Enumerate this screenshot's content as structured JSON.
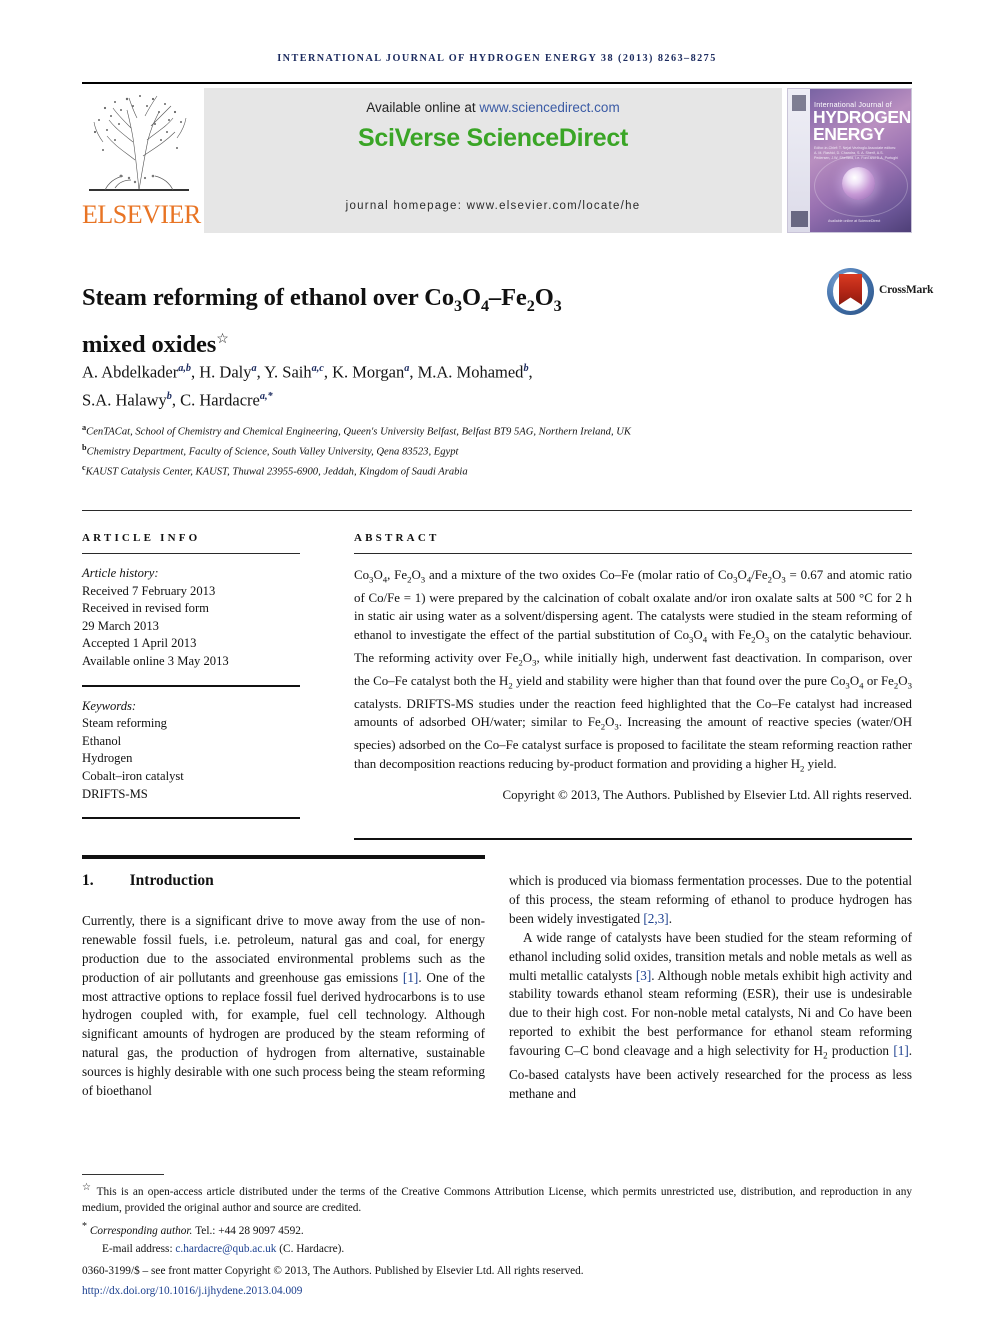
{
  "running_head": "International Journal of Hydrogen Energy 38 (2013) 8263–8275",
  "masthead": {
    "publisher": "ELSEVIER",
    "available_prefix": "Available online at ",
    "available_url": "www.sciencedirect.com",
    "platform": "SciVerse ScienceDirect",
    "homepage": "journal homepage: www.elsevier.com/locate/he",
    "cover": {
      "line_small": "International Journal of",
      "line_1": "HYDROGEN",
      "line_2": "ENERGY",
      "editors": "Editor-in-Chief: T. Nejat Veziroglu    Associate editors: A. M. Rashid, D. Chandra, S. A. Sherif, A.S. Pedersen, J.W. Sheffield, I.e. Ford and D.A. Portughi",
      "footer": "Available online at ScienceDirect"
    }
  },
  "crossmark": {
    "label": "CrossMark"
  },
  "article": {
    "title_line_1": "Steam reforming of ethanol over Co",
    "title_sub_1": "3",
    "title_mid_1": "O",
    "title_sub_2": "4",
    "title_mid_2": "–Fe",
    "title_sub_3": "2",
    "title_mid_3": "O",
    "title_sub_4": "3",
    "title_line_2": "mixed oxides",
    "title_marker": "☆",
    "title_plain": "Steam reforming of ethanol over Co3O4–Fe2O3 mixed oxides",
    "authors_line_1": "A. Abdelkader",
    "authors_line_1_rest": ", H. Daly",
    "authors_plain": "A. Abdelkader a,b, H. Daly a, Y. Saih a,c, K. Morgan a, M.A. Mohamed b, S.A. Halawy b, C. Hardacre a,*",
    "affiliations": [
      {
        "marker": "a",
        "text": "CenTACat, School of Chemistry and Chemical Engineering, Queen's University Belfast, Belfast BT9 5AG, Northern Ireland, UK"
      },
      {
        "marker": "b",
        "text": "Chemistry Department, Faculty of Science, South Valley University, Qena 83523, Egypt"
      },
      {
        "marker": "c",
        "text": "KAUST Catalysis Center, KAUST, Thuwal 23955-6900, Jeddah, Kingdom of Saudi Arabia"
      }
    ]
  },
  "info": {
    "heading": "Article info",
    "history_label": "Article history:",
    "history": [
      "Received 7 February 2013",
      "Received in revised form",
      "29 March 2013",
      "Accepted 1 April 2013",
      "Available online 3 May 2013"
    ],
    "keywords_label": "Keywords:",
    "keywords": [
      "Steam reforming",
      "Ethanol",
      "Hydrogen",
      "Cobalt–iron catalyst",
      "DRIFTS-MS"
    ]
  },
  "abstract": {
    "heading": "Abstract",
    "copyright": "Copyright © 2013, The Authors. Published by Elsevier Ltd. All rights reserved."
  },
  "introduction": {
    "number": "1.",
    "heading": "Introduction"
  },
  "footnotes": {
    "open_access": "This is an open-access article distributed under the terms of the Creative Commons Attribution License, which permits unrestricted use, distribution, and reproduction in any medium, provided the original author and source are credited.",
    "corresponding_label": "Corresponding author.",
    "corresponding_tel": "Tel.: +44 28 9097 4592.",
    "email_label": "E-mail address: ",
    "email": "c.hardacre@qub.ac.uk",
    "email_suffix": " (C. Hardacre).",
    "issn_line": "0360-3199/$ – see front matter Copyright © 2013, The Authors. Published by Elsevier Ltd. All rights reserved.",
    "doi": "http://dx.doi.org/10.1016/j.ijhydene.2013.04.009"
  },
  "colors": {
    "runhead": "#1b2a5e",
    "sciverse_green": "#3aa526",
    "elsevier_orange": "#e87424",
    "link_blue": "#1b3f8f"
  }
}
